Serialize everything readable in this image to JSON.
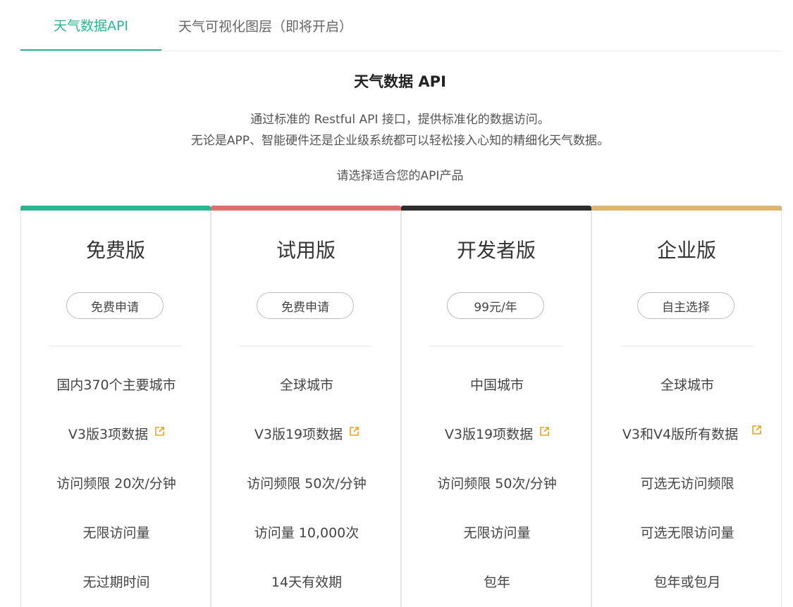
{
  "tabs": [
    {
      "label": "天气数据API",
      "active": true
    },
    {
      "label": "天气可视化图层（即将开启）",
      "active": false
    }
  ],
  "intro": {
    "title": "天气数据 API",
    "line1": "通过标准的 Restful API 接口，提供标准化的数据访问。",
    "line2": "无论是APP、智能硬件还是企业级系统都可以轻松接入心知的精细化天气数据。",
    "prompt": "请选择适合您的API产品"
  },
  "plans": [
    {
      "name": "免费版",
      "accent": "#2bb593",
      "button": "免费申请",
      "features": [
        "国内370个主要城市",
        "V3版3项数据",
        "访问频限 20次/分钟",
        "无限访问量",
        "无过期时间"
      ]
    },
    {
      "name": "试用版",
      "accent": "#e07070",
      "button": "免费申请",
      "features": [
        "全球城市",
        "V3版19项数据",
        "访问频限 50次/分钟",
        "访问量 10,000次",
        "14天有效期"
      ]
    },
    {
      "name": "开发者版",
      "accent": "#2d2d2d",
      "button": "99元/年",
      "features": [
        "中国城市",
        "V3版19项数据",
        "访问频限 50次/分钟",
        "无限访问量",
        "包年"
      ]
    },
    {
      "name": "企业版",
      "accent": "#ddb570",
      "button": "自主选择",
      "features": [
        "全球城市",
        "V3和V4版所有数据",
        "可选无访问频限",
        "可选无限访问量",
        "包年或包月"
      ]
    }
  ],
  "icons": {
    "external_link": "external-link-icon",
    "external_link_color": "#f0a020"
  }
}
